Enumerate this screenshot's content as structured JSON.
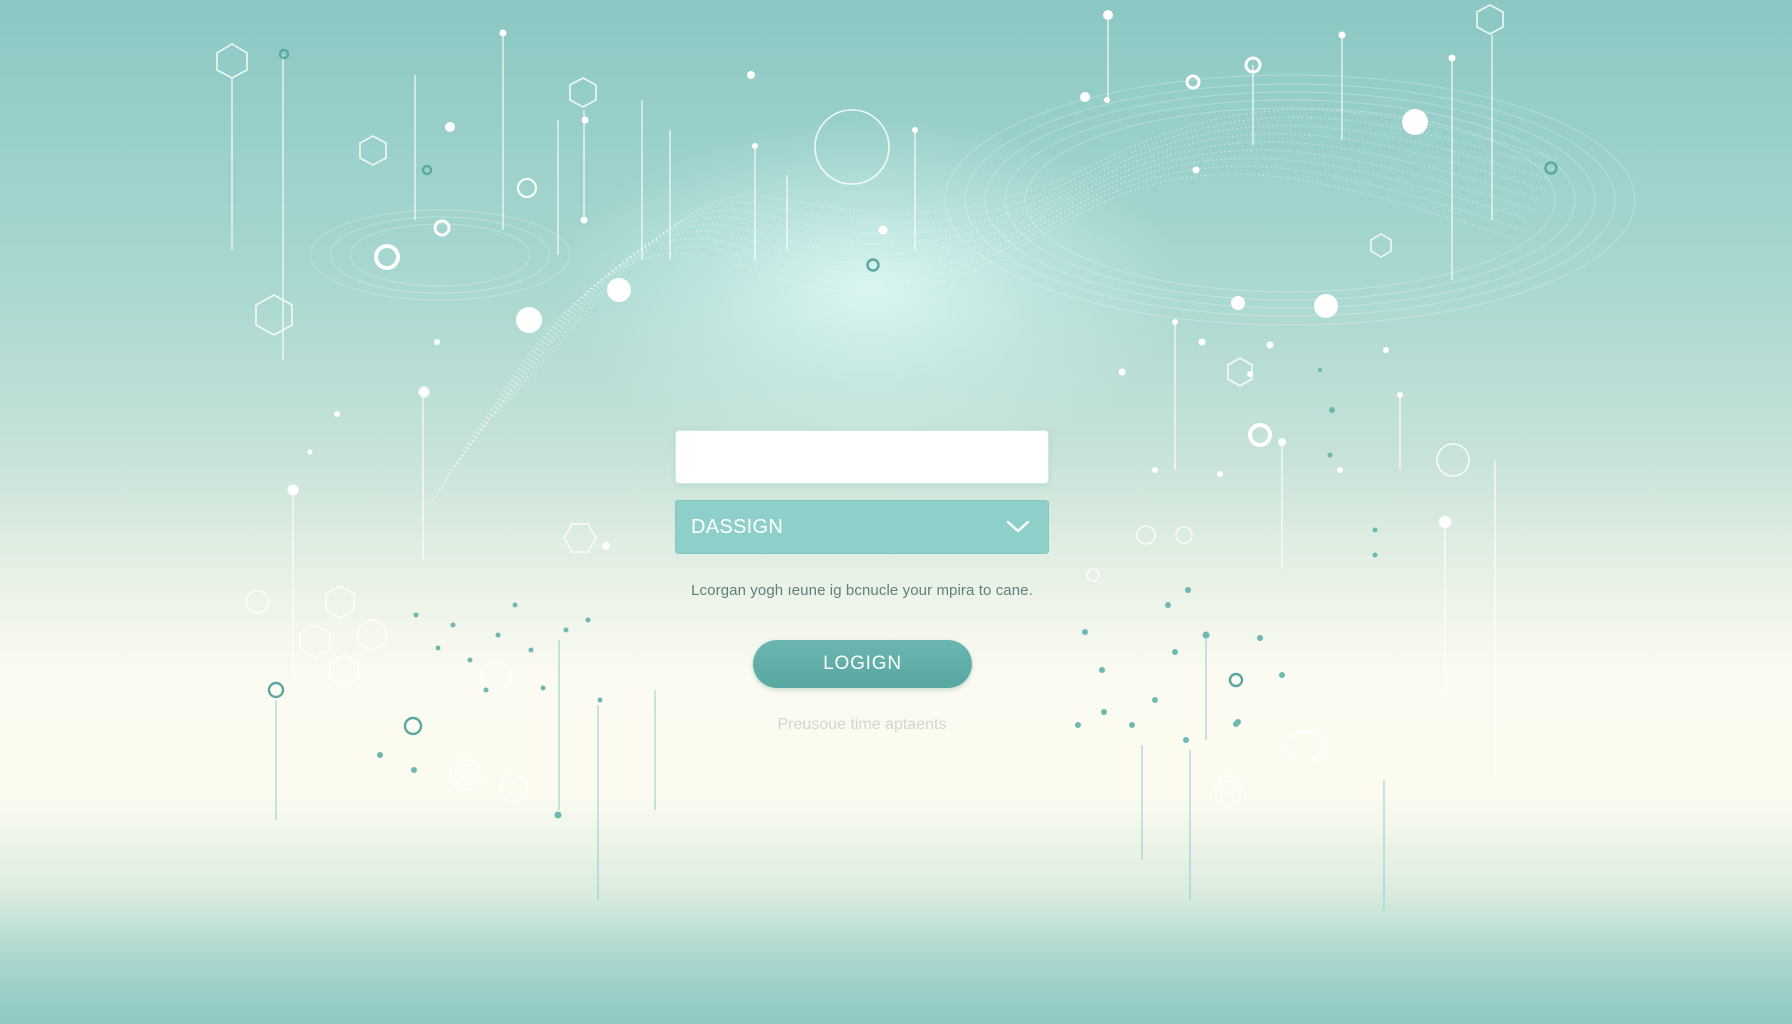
{
  "login_form": {
    "username_value": "",
    "select_value": "DASSIGN",
    "helper_text": "Lcorgan yogh ıeune ig bcnucle your mpira to cane.",
    "login_label": "LOGIGN",
    "footer_link_text": "Preusoue time aptaents"
  },
  "colors": {
    "accent": "#5eaca6",
    "select_bg": "#8fcfca",
    "background_top": "#8cc7c3",
    "background_mid": "#fbfbf1"
  },
  "icons": {
    "select_arrow": "chevron-down-icon"
  }
}
